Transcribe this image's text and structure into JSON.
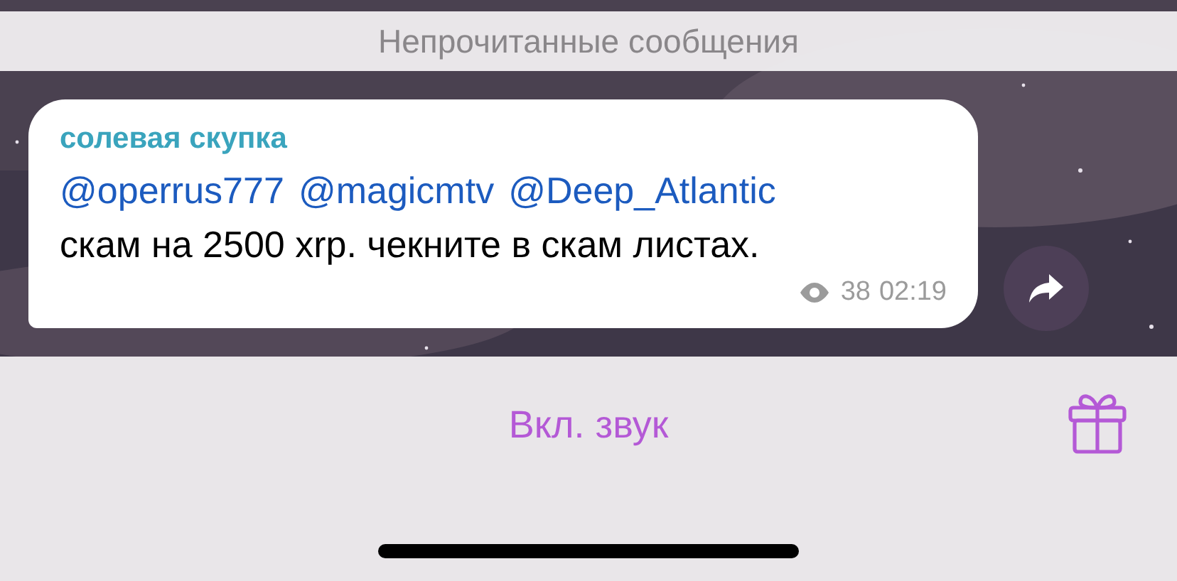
{
  "unread_banner": {
    "label": "Непрочитанные сообщения"
  },
  "message": {
    "sender": "солевая скупка",
    "mentions": [
      "@operrus777",
      "@magicmtv",
      "@Deep_Atlantic"
    ],
    "text": "скам на 2500 xrp. чекните в скам листах.",
    "views": "38",
    "time": "02:19"
  },
  "bottom_bar": {
    "button": "Вкл. звук"
  }
}
